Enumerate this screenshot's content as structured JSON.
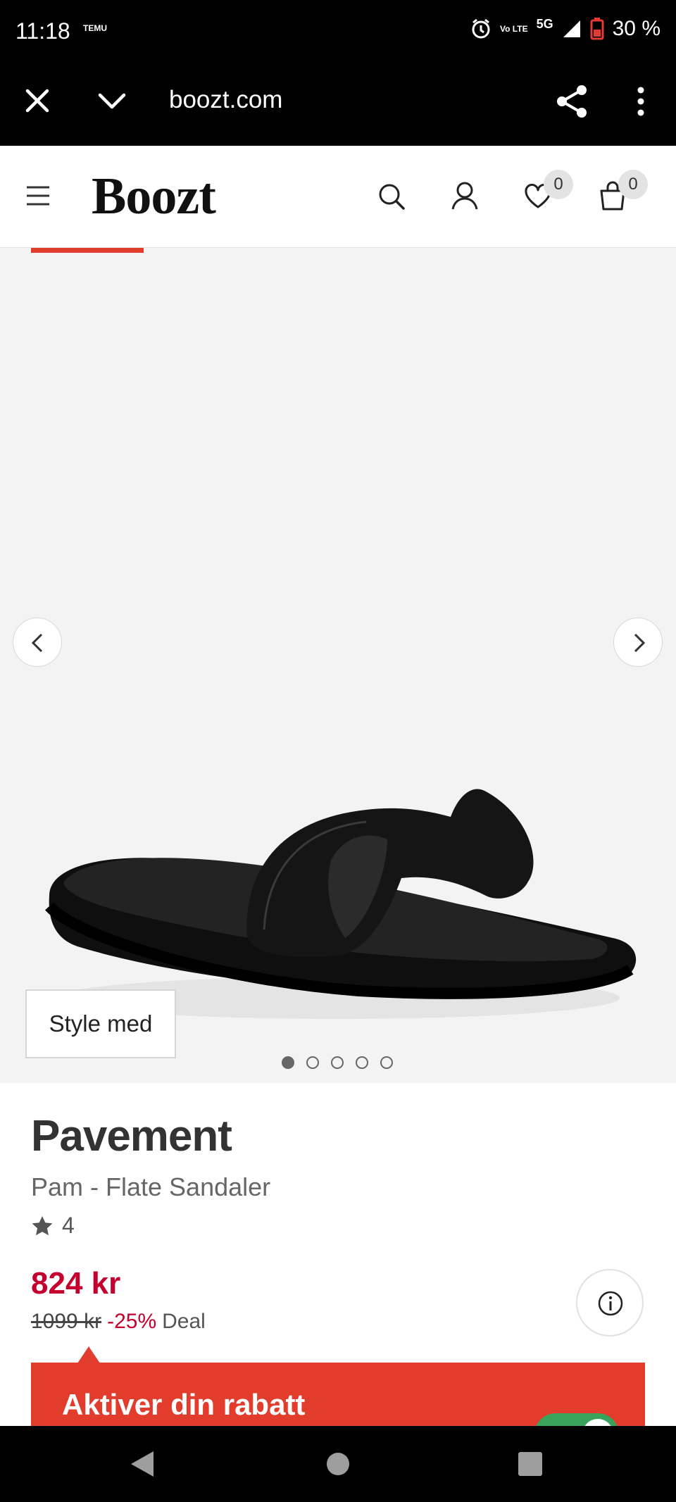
{
  "status_bar": {
    "time": "11:18",
    "notification": "TEMU",
    "network_volte": "Vo LTE",
    "network_type": "5G",
    "battery": "30 %"
  },
  "browser": {
    "url": "boozt.com",
    "icons": [
      "close-icon",
      "chevron-down-icon",
      "share-icon",
      "more-vertical-icon"
    ]
  },
  "header": {
    "logo": "Boozt",
    "wishlist_count": "0",
    "cart_count": "0",
    "icons": [
      "menu-icon",
      "search-icon",
      "user-icon",
      "heart-icon",
      "bag-icon"
    ]
  },
  "gallery": {
    "style_with_label": "Style med",
    "image_count": 5,
    "active_index": 0
  },
  "product": {
    "brand": "Pavement",
    "name": "Pam - Flate Sandaler",
    "rating": "4",
    "price": "824 kr",
    "old_price": "1099 kr",
    "discount": "-25%",
    "deal_label": "Deal"
  },
  "promo": {
    "title": "Aktiver din rabatt",
    "toggle_on": true
  },
  "colors": {
    "accent_red": "#e23c2c",
    "price_red": "#c4002e",
    "toggle_green": "#3aa35b"
  }
}
